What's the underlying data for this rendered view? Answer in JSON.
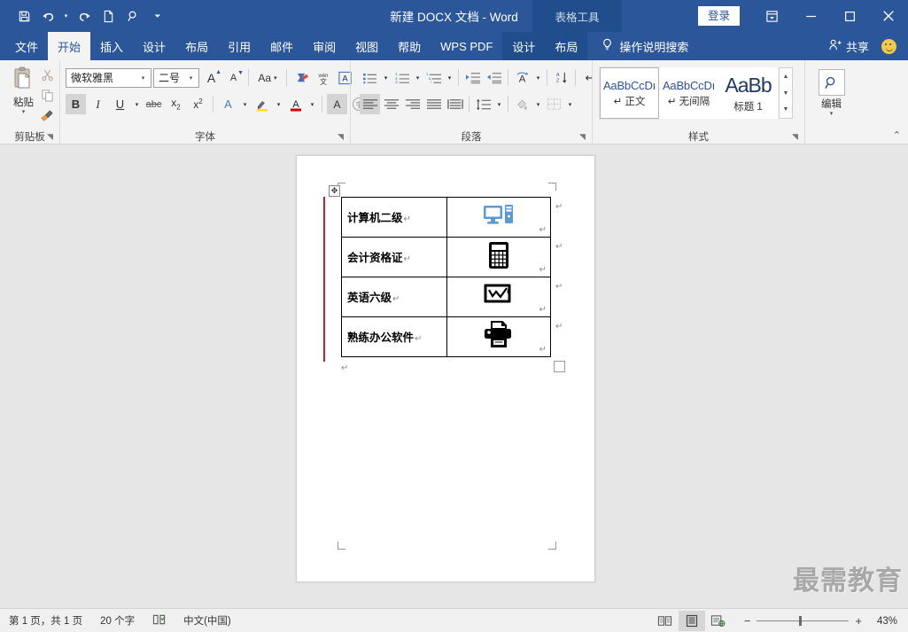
{
  "titlebar": {
    "document_title": "新建 DOCX 文档  -  Word",
    "contextual_tools_label": "表格工具",
    "signin_label": "登录",
    "qat": [
      {
        "name": "save-icon",
        "glyph": "save"
      },
      {
        "name": "undo-icon",
        "glyph": "undo"
      },
      {
        "name": "redo-icon",
        "glyph": "redo"
      },
      {
        "name": "new-document-icon",
        "glyph": "page"
      },
      {
        "name": "search-icon",
        "glyph": "magnifier"
      },
      {
        "name": "customize-qat-icon",
        "glyph": "caret"
      }
    ],
    "window_buttons": {
      "ribbon_display_options": "ribbon-display-options",
      "minimize": "—",
      "maximize": "□",
      "close": "✕"
    }
  },
  "tabs": {
    "items": [
      {
        "label": "文件",
        "active": false
      },
      {
        "label": "开始",
        "active": true
      },
      {
        "label": "插入",
        "active": false
      },
      {
        "label": "设计",
        "active": false
      },
      {
        "label": "布局",
        "active": false
      },
      {
        "label": "引用",
        "active": false
      },
      {
        "label": "邮件",
        "active": false
      },
      {
        "label": "审阅",
        "active": false
      },
      {
        "label": "视图",
        "active": false
      },
      {
        "label": "帮助",
        "active": false
      },
      {
        "label": "WPS PDF",
        "active": false
      }
    ],
    "contextual": [
      {
        "label": "设计"
      },
      {
        "label": "布局"
      }
    ],
    "tell_me": "操作说明搜索",
    "share": "共享"
  },
  "ribbon": {
    "clipboard": {
      "group_label": "剪贴板",
      "paste_label": "粘贴",
      "cut_label": "剪切",
      "copy_label": "复制",
      "format_painter_label": "格式刷"
    },
    "font": {
      "group_label": "字体",
      "font_name": "微软雅黑",
      "font_size": "二号",
      "grow_font": "A",
      "shrink_font": "A",
      "change_case": "Aa",
      "clear_formatting": "清除所有格式",
      "phonetic_guide": "拼音指南",
      "char_border": "A",
      "bold": "B",
      "italic": "I",
      "underline": "U",
      "strikethrough": "abc",
      "subscript": "x₂",
      "superscript": "x²",
      "text_effects": "A",
      "highlight": "ab",
      "font_color": "A",
      "char_shading": "A",
      "enclose_char": "字"
    },
    "paragraph": {
      "group_label": "段落",
      "bullets": "项目符号",
      "numbering": "编号",
      "multilevel": "多级列表",
      "decrease_indent": "减少缩进量",
      "increase_indent": "增加缩进量",
      "asian_layout": "中文版式",
      "sort": "排序",
      "show_marks": "显示编辑标记",
      "align_left": "左对齐",
      "align_center": "居中",
      "align_right": "右对齐",
      "justify": "两端对齐",
      "distribute": "分散对齐",
      "line_spacing": "行和段落间距",
      "shading": "底纹",
      "borders": "边框"
    },
    "styles": {
      "group_label": "样式",
      "items": [
        {
          "preview": "AaBbCcDı",
          "name": "↵ 正文",
          "selected": true
        },
        {
          "preview": "AaBbCcDı",
          "name": "↵ 无间隔",
          "selected": false
        },
        {
          "preview": "AaBb",
          "name": "标题 1",
          "selected": false,
          "big": true
        }
      ]
    },
    "editing": {
      "group_label": "编辑",
      "button_label": "编辑"
    }
  },
  "document": {
    "table_rows": [
      {
        "text": "计算机二级",
        "icon": "desktop-computer-icon"
      },
      {
        "text": "会计资格证",
        "icon": "calculator-icon"
      },
      {
        "text": "英语六级",
        "icon": "presentation-chart-icon"
      },
      {
        "text": "熟练办公软件",
        "icon": "printer-icon"
      }
    ],
    "paragraph_mark": "↵",
    "watermark": "最需教育"
  },
  "statusbar": {
    "page_info": "第 1 页，共 1 页",
    "word_count": "20 个字",
    "proofing_icon": "proofing-icon",
    "language": "中文(中国)",
    "views": [
      {
        "name": "read-mode-view",
        "active": false
      },
      {
        "name": "print-layout-view",
        "active": true
      },
      {
        "name": "web-layout-view",
        "active": false
      }
    ],
    "zoom_out": "−",
    "zoom_in": "+",
    "zoom_level": "43%"
  },
  "colors": {
    "ribbon_blue": "#2b579a",
    "contextual_blue": "#204d8c",
    "ribbon_bg": "#f3f3f3",
    "doc_bg": "#e6e6e6",
    "change_bar": "#d01c1c",
    "accent_icon_blue": "#5b9bd5"
  }
}
